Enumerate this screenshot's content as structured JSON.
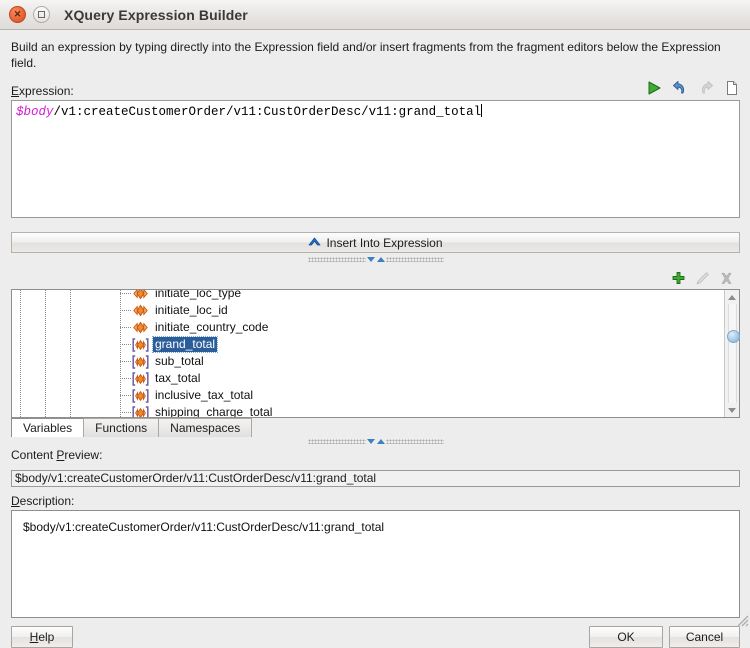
{
  "window": {
    "title": "XQuery Expression Builder",
    "close_icon": "close-icon",
    "maximize_icon": "maximize-icon"
  },
  "intro": "Build an expression by typing directly into the Expression field and/or insert fragments from the fragment editors below the Expression field.",
  "expression": {
    "label": "Expression:",
    "variable_token": "$body",
    "path_text": "/v1:createCustomerOrder/v11:CustOrderDesc/v11:grand_total",
    "full_text": "$body/v1:createCustomerOrder/v11:CustOrderDesc/v11:grand_total",
    "toolbar": [
      {
        "name": "run-expression-icon",
        "label": "Run",
        "enabled": true
      },
      {
        "name": "undo-icon",
        "label": "Undo",
        "enabled": true
      },
      {
        "name": "redo-icon",
        "label": "Redo",
        "enabled": false
      },
      {
        "name": "new-document-icon",
        "label": "New",
        "enabled": true
      }
    ]
  },
  "insert_button": {
    "label": "Insert Into Expression",
    "icon": "chevron-up-icon"
  },
  "fragment_toolbar": [
    {
      "name": "add-icon",
      "label": "Add",
      "enabled": true
    },
    {
      "name": "edit-pencil-icon",
      "label": "Edit",
      "enabled": false
    },
    {
      "name": "delete-icon",
      "label": "Delete",
      "enabled": false
    }
  ],
  "tree": {
    "nodes": [
      {
        "label": "initiate_loc_type",
        "icon": "element-icon",
        "selected": false,
        "clipped": true
      },
      {
        "label": "initiate_loc_id",
        "icon": "element-icon",
        "selected": false,
        "clipped": false
      },
      {
        "label": "initiate_country_code",
        "icon": "element-icon",
        "selected": false,
        "clipped": false
      },
      {
        "label": "grand_total",
        "icon": "repeating-element-icon",
        "selected": true,
        "clipped": false
      },
      {
        "label": "sub_total",
        "icon": "repeating-element-icon",
        "selected": false,
        "clipped": false
      },
      {
        "label": "tax_total",
        "icon": "repeating-element-icon",
        "selected": false,
        "clipped": false
      },
      {
        "label": "inclusive_tax_total",
        "icon": "repeating-element-icon",
        "selected": false,
        "clipped": false
      },
      {
        "label": "shipping_charge_total",
        "icon": "repeating-element-icon",
        "selected": false,
        "clipped": true
      }
    ],
    "scrollbar": {
      "up_icon": "scroll-up-icon",
      "down_icon": "scroll-down-icon",
      "thumb_position_percent": 26
    }
  },
  "tabs": [
    {
      "label": "Variables",
      "active": true
    },
    {
      "label": "Functions",
      "active": false
    },
    {
      "label": "Namespaces",
      "active": false
    }
  ],
  "content_preview": {
    "label": "Content Preview:",
    "value": "$body/v1:createCustomerOrder/v11:CustOrderDesc/v11:grand_total"
  },
  "description": {
    "label": "Description:",
    "value": "$body/v1:createCustomerOrder/v11:CustOrderDesc/v11:grand_total"
  },
  "buttons": {
    "help": "Help",
    "ok": "OK",
    "cancel": "Cancel"
  },
  "colors": {
    "selection_blue": "#2c5d9b",
    "variable_magenta": "#d419d4",
    "element_orange": "#e8751a",
    "bracket_purple": "#6a5fa8",
    "accent_blue": "#3d7fc1",
    "run_green": "#3faa34"
  }
}
